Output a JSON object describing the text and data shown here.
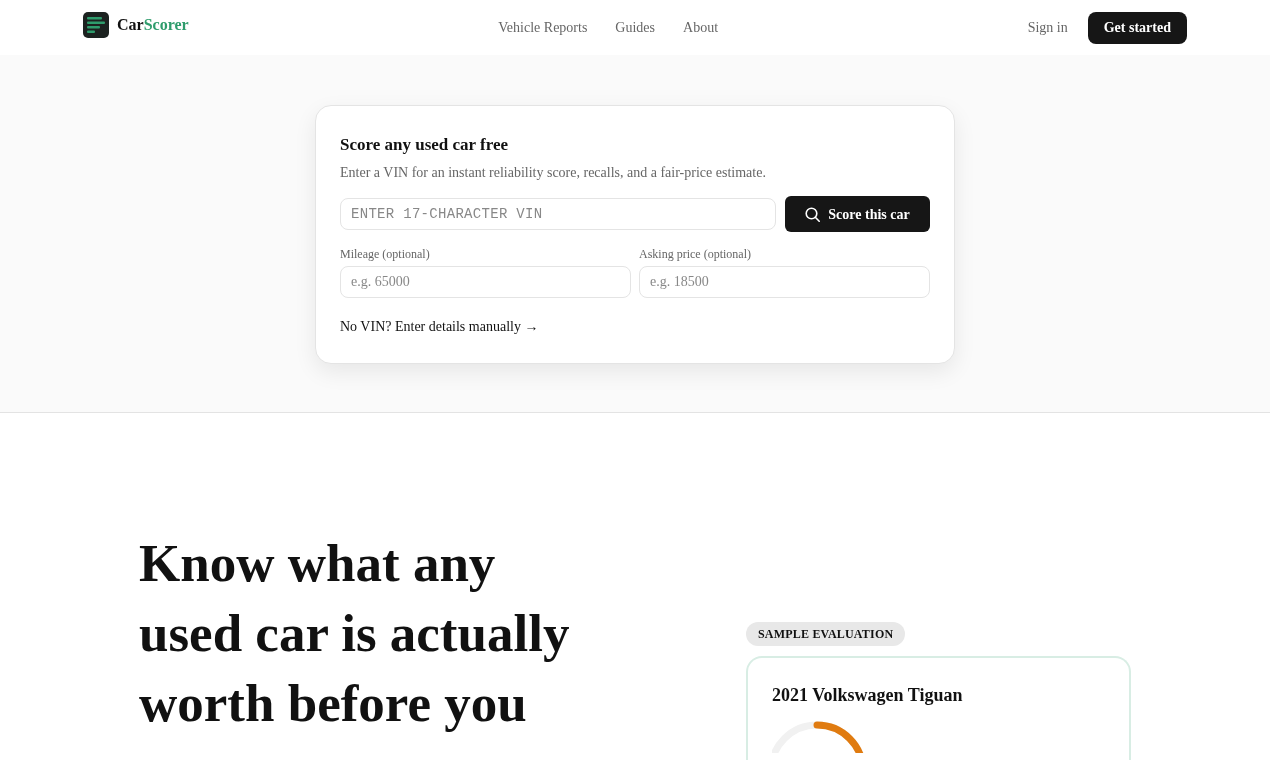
{
  "header": {
    "brand": {
      "prefix": "Car",
      "accent": "Scorer"
    },
    "nav_links": [
      "Vehicle Reports",
      "Guides",
      "About"
    ],
    "sign_in": "Sign in",
    "get_started": "Get started"
  },
  "vin_form": {
    "title": "Score any used car free",
    "subtitle": "Enter a VIN for an instant reliability score, recalls, and a fair-price estimate.",
    "vin_field": {
      "placeholder": "ENTER 17-CHARACTER VIN"
    },
    "submit": "Score this car",
    "fields": [
      {
        "label": "Mileage (optional)",
        "placeholder": "e.g. 65000"
      },
      {
        "label": "Asking price (optional)",
        "placeholder": "e.g. 18500"
      }
    ],
    "manual_link": "No VIN? Enter details manually →"
  },
  "hero": {
    "headline": "Know what any used car is actually worth before you"
  },
  "sample": {
    "badge": "SAMPLE EVALUATION",
    "card": {
      "title": "2021 Volkswagen Tiguan"
    }
  }
}
